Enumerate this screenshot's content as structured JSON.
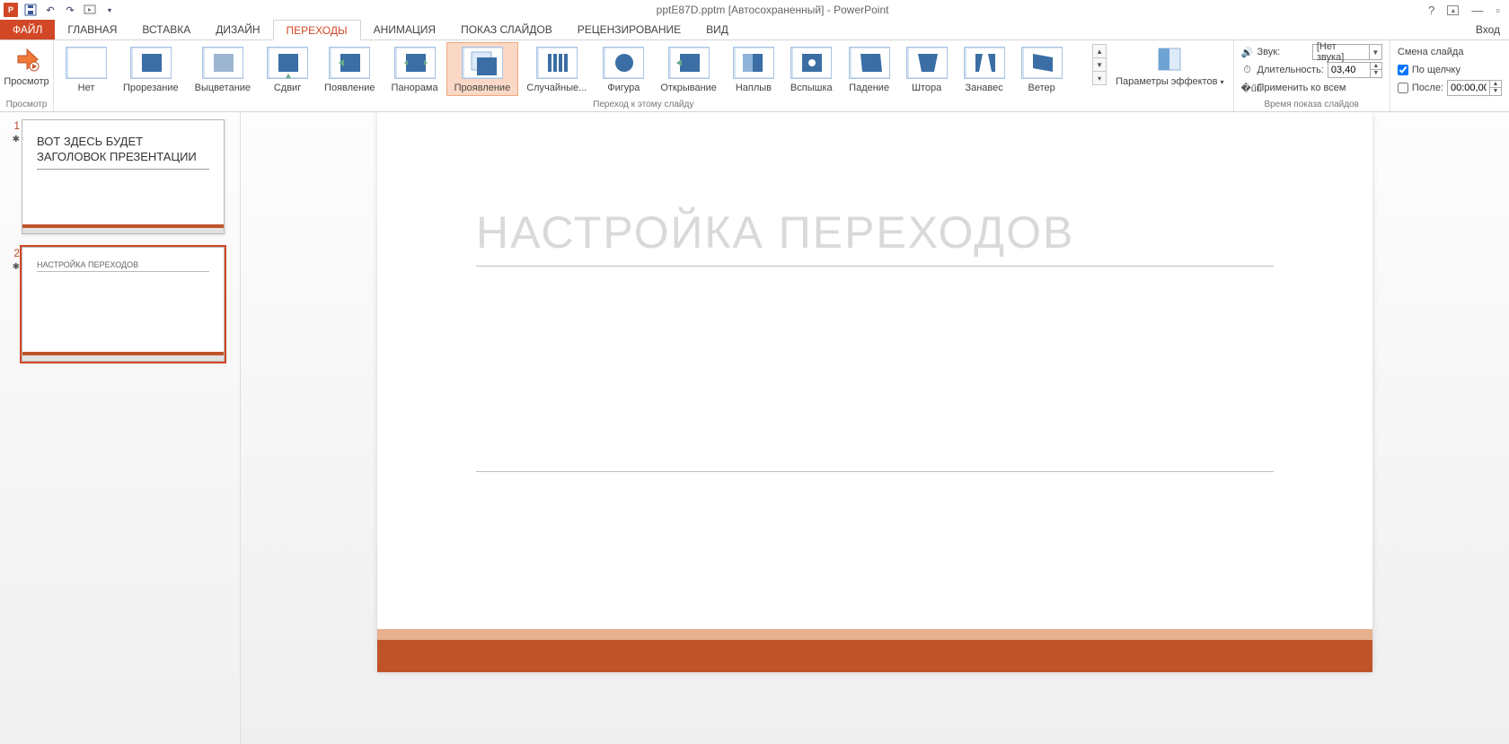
{
  "title": "pptE87D.pptm [Автосохраненный] - PowerPoint",
  "signin": "Вход",
  "tabs": {
    "file": "ФАЙЛ",
    "home": "ГЛАВНАЯ",
    "insert": "ВСТАВКА",
    "design": "ДИЗАЙН",
    "transitions": "ПЕРЕХОДЫ",
    "animations": "АНИМАЦИЯ",
    "slideshow": "ПОКАЗ СЛАЙДОВ",
    "review": "РЕЦЕНЗИРОВАНИЕ",
    "view": "ВИД"
  },
  "ribbon": {
    "preview_btn": "Просмотр",
    "preview_group": "Просмотр",
    "transitions_group": "Переход к этому слайду",
    "timing_group": "Время показа слайдов",
    "effect_options": "Параметры эффектов",
    "gallery": [
      {
        "id": "none",
        "label": "Нет"
      },
      {
        "id": "cut",
        "label": "Прорезание"
      },
      {
        "id": "fade",
        "label": "Выцветание"
      },
      {
        "id": "push",
        "label": "Сдвиг"
      },
      {
        "id": "wipe",
        "label": "Появление"
      },
      {
        "id": "split",
        "label": "Панорама"
      },
      {
        "id": "reveal",
        "label": "Проявление"
      },
      {
        "id": "random",
        "label": "Случайные..."
      },
      {
        "id": "shape",
        "label": "Фигура"
      },
      {
        "id": "uncover",
        "label": "Открывание"
      },
      {
        "id": "cover",
        "label": "Наплыв"
      },
      {
        "id": "flash",
        "label": "Вспышка"
      },
      {
        "id": "fall",
        "label": "Падение"
      },
      {
        "id": "drape",
        "label": "Штора"
      },
      {
        "id": "curtain",
        "label": "Занавес"
      },
      {
        "id": "wind",
        "label": "Ветер"
      }
    ],
    "selected_transition": "reveal",
    "sound_label": "Звук:",
    "sound_value": "[Нет звука]",
    "duration_label": "Длительность:",
    "duration_value": "03,40",
    "apply_all": "Применить ко всем",
    "advance_label": "Смена слайда",
    "on_click_label": "По щелчку",
    "on_click_checked": true,
    "after_label": "После:",
    "after_checked": false,
    "after_value": "00:00,00"
  },
  "slides": {
    "s1": {
      "num": "1",
      "title": "ВОТ ЗДЕСЬ БУДЕТ ЗАГОЛОВОК ПРЕЗЕНТАЦИИ"
    },
    "s2": {
      "num": "2",
      "title": "НАСТРОЙКА ПЕРЕХОДОВ"
    }
  },
  "canvas": {
    "title": "НАСТРОЙКА ПЕРЕХОДОВ"
  }
}
